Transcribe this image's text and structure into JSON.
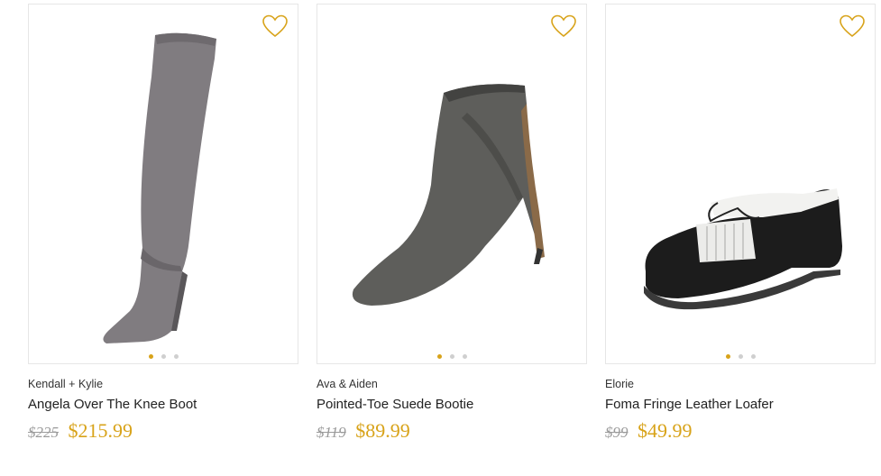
{
  "colors": {
    "accent": "#d8a31a",
    "original_price": "#9a9a9a",
    "border": "#e6e6e6"
  },
  "products": [
    {
      "brand": "Kendall + Kylie",
      "name": "Angela Over The Knee Boot",
      "original_price": "$225",
      "sale_price": "$215.99",
      "image_icon": "over-the-knee-boot",
      "carousel": {
        "count": 3,
        "active": 1
      }
    },
    {
      "brand": "Ava & Aiden",
      "name": "Pointed-Toe Suede Bootie",
      "original_price": "$119",
      "sale_price": "$89.99",
      "image_icon": "suede-bootie",
      "carousel": {
        "count": 3,
        "active": 1
      }
    },
    {
      "brand": "Elorie",
      "name": "Foma Fringe Leather Loafer",
      "original_price": "$99",
      "sale_price": "$49.99",
      "image_icon": "fringe-loafer",
      "carousel": {
        "count": 3,
        "active": 1
      }
    }
  ]
}
